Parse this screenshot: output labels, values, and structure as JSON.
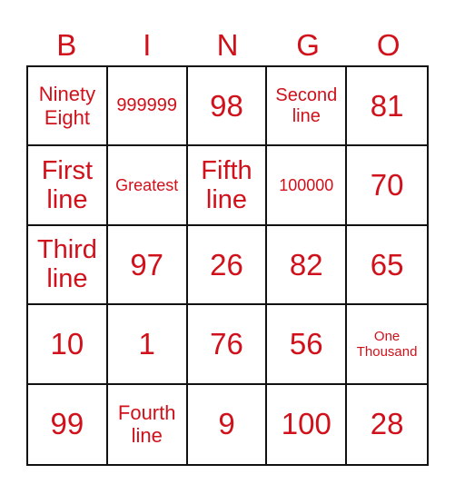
{
  "card": {
    "header": [
      "B",
      "I",
      "N",
      "G",
      "O"
    ],
    "rows": [
      [
        {
          "text": "Ninety Eight",
          "size": "m"
        },
        {
          "text": "999999",
          "size": "sm"
        },
        {
          "text": "98",
          "size": "xl"
        },
        {
          "text": "Second line",
          "size": "sm"
        },
        {
          "text": "81",
          "size": "xl"
        }
      ],
      [
        {
          "text": "First line",
          "size": "l"
        },
        {
          "text": "Greatest",
          "size": "s"
        },
        {
          "text": "Fifth line",
          "size": "l"
        },
        {
          "text": "100000",
          "size": "s"
        },
        {
          "text": "70",
          "size": "xl"
        }
      ],
      [
        {
          "text": "Third line",
          "size": "l"
        },
        {
          "text": "97",
          "size": "xl"
        },
        {
          "text": "26",
          "size": "xl"
        },
        {
          "text": "82",
          "size": "xl"
        },
        {
          "text": "65",
          "size": "xl"
        }
      ],
      [
        {
          "text": "10",
          "size": "xl"
        },
        {
          "text": "1",
          "size": "xl"
        },
        {
          "text": "76",
          "size": "xl"
        },
        {
          "text": "56",
          "size": "xl"
        },
        {
          "text": "One Thousand",
          "size": "xs"
        }
      ],
      [
        {
          "text": "99",
          "size": "xl"
        },
        {
          "text": "Fourth line",
          "size": "m"
        },
        {
          "text": "9",
          "size": "xl"
        },
        {
          "text": "100",
          "size": "xl"
        },
        {
          "text": "28",
          "size": "xl"
        }
      ]
    ],
    "colors": {
      "text": "#d0111b",
      "border": "#111111"
    }
  }
}
